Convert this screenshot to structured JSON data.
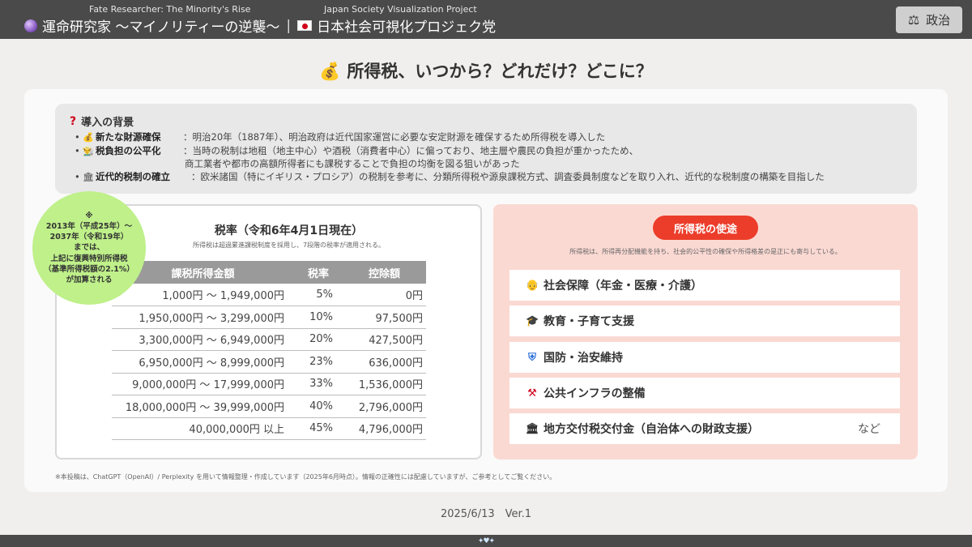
{
  "header": {
    "subtitle_left": "Fate Researcher: The Minority's Rise",
    "subtitle_right": "Japan Society Visualization Project",
    "title_left": "運命研究家 〜マイノリティーの逆襲〜",
    "separator": "|",
    "title_right": "日本社会可視化プロジェク党",
    "politics_button": "政治",
    "icons": {
      "orb": "crystal-ball-icon",
      "flag": "japan-flag-icon",
      "gavel": "gavel-icon"
    }
  },
  "page_title": "所得税、いつから？どれだけ？どこに？",
  "background": {
    "heading": "導入の背景",
    "items": [
      {
        "icon": "money-bag-icon",
        "term": "新たな財源確保",
        "text": "：明治20年（1887年）、明治政府は近代国家運営に必要な安定財源を確保するため所得税を導入した"
      },
      {
        "icon": "farmer-icon",
        "term": "税負担の公平化",
        "text": "：当時の税制は地租（地主中心）や酒税（消費者中心）に偏っており、地主層や農民の負担が重かったため、",
        "continuation": "商工業者や都市の高額所得者にも課税することで負担の均衡を図る狙いがあった"
      },
      {
        "icon": "institution-icon",
        "term": "近代的税制の確立",
        "text": "：欧米諸国（特にイギリス・プロシア）の税制を参考に、分類所得税や源泉課税方式、調査委員制度などを取り入れ、近代的な税制度の構築を目指した"
      }
    ]
  },
  "rate": {
    "title": "税率（令和6年4月1日現在）",
    "note": "所得税は超過累進課税制度を採用し、7段階の税率が適用される。",
    "columns": [
      "課税所得金額",
      "税率",
      "控除額"
    ],
    "rows": [
      [
        "1,000円 〜 1,949,000円",
        "5%",
        "0円"
      ],
      [
        "1,950,000円 〜 3,299,000円",
        "10%",
        "97,500円"
      ],
      [
        "3,300,000円 〜 6,949,000円",
        "20%",
        "427,500円"
      ],
      [
        "6,950,000円 〜 8,999,000円",
        "23%",
        "636,000円"
      ],
      [
        "9,000,000円 〜 17,999,000円",
        "33%",
        "1,536,000円"
      ],
      [
        "18,000,000円 〜 39,999,000円",
        "40%",
        "2,796,000円"
      ],
      [
        "40,000,000円 以上",
        "45%",
        "4,796,000円"
      ]
    ],
    "circle_lines": [
      "※",
      "2013年（平成25年）〜",
      "2037年（令和19年）",
      "までは、",
      "上記に復興特別所得税",
      "（基準所得税額の2.1%）",
      "が加算される"
    ]
  },
  "usage": {
    "pill": "所得税の使途",
    "note": "所得税は、所得再分配機能を持ち、社会的公平性の確保や所得格差の是正にも寄与している。",
    "items": [
      {
        "icon": "elderly-icon",
        "label": "社会保障（年金・医療・介護）"
      },
      {
        "icon": "graduation-cap-icon",
        "label": "教育・子育て支援"
      },
      {
        "icon": "shield-icon",
        "label": "国防・治安維持"
      },
      {
        "icon": "construction-icon",
        "label": "公共インフラの整備"
      },
      {
        "icon": "institution-icon",
        "label": "地方交付税交付金（自治体への財政支援）"
      }
    ],
    "etc": "など"
  },
  "disclaimer": "※本投稿は、ChatGPT（OpenAI）/ Perplexity を用いて情報整理・作成しています（2025年6月時点）。情報の正確性には配慮していますが、ご参考としてご覧ください。",
  "version": "2025/6/13　Ver.1",
  "colors": {
    "topbar": "#4a4a4a",
    "accent_red": "#ec3d2a",
    "usage_bg": "#fbd9d3",
    "circle_green": "#bff08a"
  }
}
